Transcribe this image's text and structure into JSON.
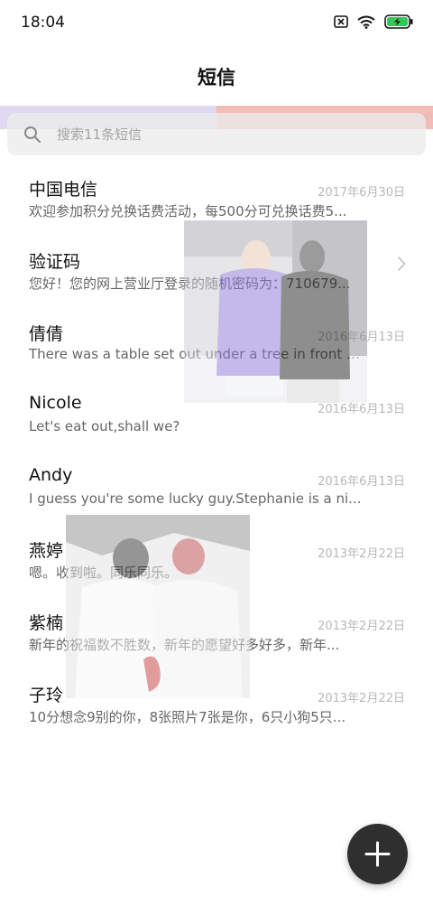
{
  "status_bar": {
    "time": "18:04",
    "icons": [
      "sim-off-icon",
      "wifi-icon",
      "battery-charging-icon"
    ]
  },
  "header": {
    "title": "短信"
  },
  "search": {
    "placeholder": "搜索11条短信",
    "icon": "search-icon"
  },
  "conversations": [
    {
      "name": "中国电信",
      "date": "2017年6月30日",
      "preview": "欢迎参加积分兑换话费活动，每500分可兑换话费5...",
      "chevron": false
    },
    {
      "name": "验证码",
      "date": "",
      "preview": "您好！您的网上营业厅登录的随机密码为：710679...",
      "chevron": true
    },
    {
      "name": "倩倩",
      "date": "2016年6月13日",
      "preview": "There was a table set out under a tree in front of ...",
      "chevron": false
    },
    {
      "name": "Nicole",
      "date": "2016年6月13日",
      "preview": "Let's eat out,shall we?",
      "chevron": false
    },
    {
      "name": "Andy",
      "date": "2016年6月13日",
      "preview": "I guess you're some lucky guy.Stephanie is a ni...",
      "chevron": false
    },
    {
      "name": "燕婷",
      "date": "2013年2月22日",
      "preview": "嗯。收到啦。同乐同乐。",
      "chevron": false
    },
    {
      "name": "紫楠",
      "date": "2013年2月22日",
      "preview": "新年的祝福数不胜数，新年的愿望好多好多，新年...",
      "chevron": false
    },
    {
      "name": "子玲",
      "date": "2013年2月22日",
      "preview": "10分想念9别的你，8张照片7张是你，6只小狗5只...",
      "chevron": false
    }
  ],
  "fab": {
    "icon": "plus-icon"
  },
  "colors": {
    "accent": "#2f2f2f",
    "tint_left": "#d9d2ee",
    "tint_right": "#efb0aa",
    "purple_shirt": "#8a76d8"
  }
}
